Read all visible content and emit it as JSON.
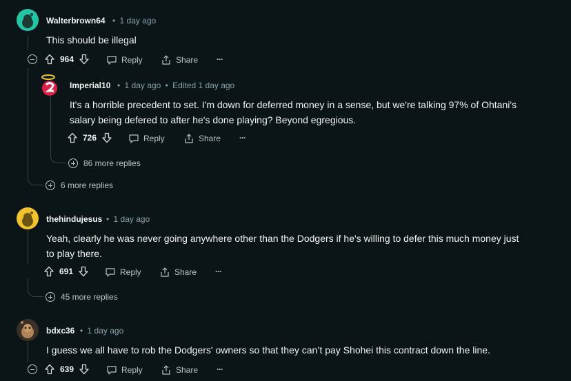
{
  "comments": [
    {
      "username": "Walterbrown64",
      "time": "1 day ago",
      "body": "This should be illegal",
      "votes": "964",
      "reply_label": "Reply",
      "share_label": "Share",
      "more_replies": "6 more replies",
      "avatar_color": "#24c5a5",
      "replies": [
        {
          "username": "Imperial10",
          "time": "1 day ago",
          "edited": "Edited 1 day ago",
          "body": "It's a horrible precedent to set. I'm down for deferred money in a sense, but we're talking 97% of Ohtani's salary being defered to after he's done playing? Beyond egregious.",
          "votes": "726",
          "reply_label": "Reply",
          "share_label": "Share",
          "more_replies": "86 more replies",
          "avatar_color": "#d9224a"
        }
      ]
    },
    {
      "username": "thehindujesus",
      "time": "1 day ago",
      "body": "Yeah, clearly he was never going anywhere other than the Dodgers if he's willing to defer this much money just to play there.",
      "votes": "691",
      "reply_label": "Reply",
      "share_label": "Share",
      "more_replies": "45 more replies",
      "avatar_color": "#f2c12e"
    },
    {
      "username": "bdxc36",
      "time": "1 day ago",
      "body": "I guess we all have to rob the Dodgers' owners so that they can’t pay Shohei this contract down the line.",
      "votes": "639",
      "reply_label": "Reply",
      "share_label": "Share",
      "avatar_color": "#8a6a4a"
    }
  ],
  "icons": {
    "upvote": "upvote-icon",
    "downvote": "downvote-icon",
    "reply": "reply-icon",
    "share": "share-icon",
    "overflow": "overflow-menu-icon",
    "collapse": "collapse-icon",
    "expand": "expand-icon"
  },
  "meta_separator": "•",
  "overflow_glyph": "···"
}
